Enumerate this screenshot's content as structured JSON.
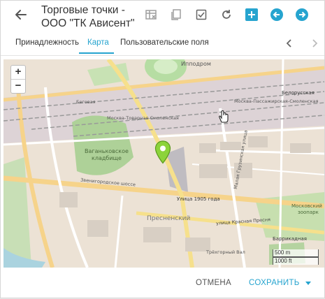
{
  "header": {
    "title_line1": "Торговые точки -",
    "title_line2": "ООО \"ТК Ависент\""
  },
  "toolbar": {
    "icons": [
      "table-icon",
      "copy-icon",
      "checkbox-icon",
      "refresh-icon",
      "add-icon",
      "prev-icon",
      "next-icon"
    ],
    "accent_color": "#26a4cf"
  },
  "tabs": [
    {
      "label": "Принадлежность"
    },
    {
      "label": "Карта"
    },
    {
      "label": "Пользовательские поля"
    }
  ],
  "map": {
    "zoom_in": "+",
    "zoom_out": "−",
    "labels": {
      "ippodrom": "Ипподром",
      "belorusskaya": "Белорусская",
      "moscow_passenger": "Москва-Пассажирская-Смоленская",
      "begovaya": "Беговая",
      "moscow_cargo": "Москва-Товарная-Смоленская",
      "vagankovo1": "Ваганьковское",
      "vagankovo2": "кладбище",
      "street_1905": "Улица 1905 года",
      "zvenigorod": "Звенигородское шоссе",
      "presnensky": "Пресненский",
      "krasnaya_presnya": "улица Красная Пресня",
      "zoo1": "Московский",
      "zoo2": "зоопарк",
      "barrikadnaya": "Баррикадная",
      "trekhgorny": "Трёхгорный Вал",
      "gruzinsky": "Малая Грузинская улица"
    },
    "scale_metric": "500 m",
    "scale_imperial": "1000 ft"
  },
  "footer": {
    "cancel_label": "ОТМЕНА",
    "save_label": "СОХРАНИТЬ"
  }
}
